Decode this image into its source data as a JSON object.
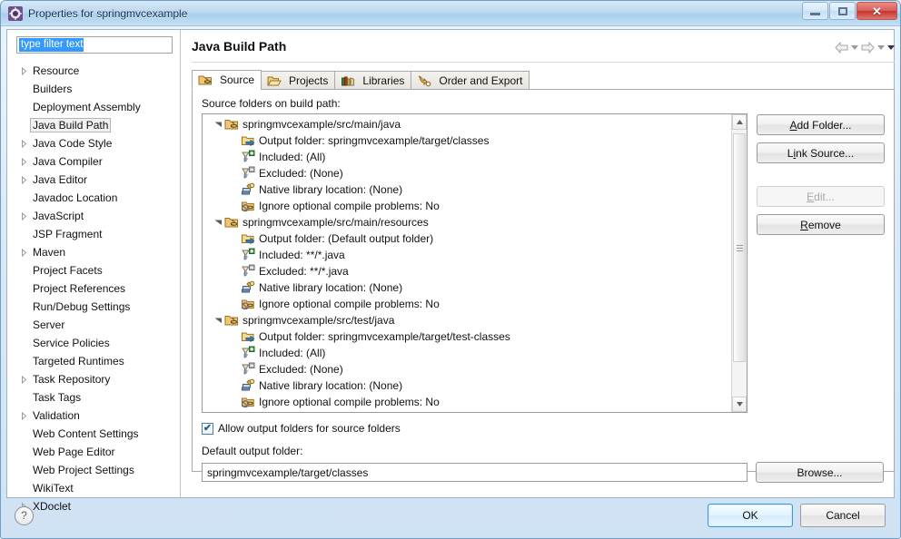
{
  "window": {
    "title": "Properties for springmvcexample",
    "icon": "properties-gear-icon",
    "buttons": {
      "minimize": "Minimize",
      "maximize": "Maximize",
      "close": "Close"
    }
  },
  "sidebar": {
    "filter": {
      "value": "type filter text",
      "placeholder": "type filter text"
    },
    "items": [
      {
        "label": "Resource",
        "expandable": true,
        "selected": false
      },
      {
        "label": "Builders",
        "expandable": false,
        "selected": false
      },
      {
        "label": "Deployment Assembly",
        "expandable": false,
        "selected": false
      },
      {
        "label": "Java Build Path",
        "expandable": false,
        "selected": true
      },
      {
        "label": "Java Code Style",
        "expandable": true,
        "selected": false
      },
      {
        "label": "Java Compiler",
        "expandable": true,
        "selected": false
      },
      {
        "label": "Java Editor",
        "expandable": true,
        "selected": false
      },
      {
        "label": "Javadoc Location",
        "expandable": false,
        "selected": false
      },
      {
        "label": "JavaScript",
        "expandable": true,
        "selected": false
      },
      {
        "label": "JSP Fragment",
        "expandable": false,
        "selected": false
      },
      {
        "label": "Maven",
        "expandable": true,
        "selected": false
      },
      {
        "label": "Project Facets",
        "expandable": false,
        "selected": false
      },
      {
        "label": "Project References",
        "expandable": false,
        "selected": false
      },
      {
        "label": "Run/Debug Settings",
        "expandable": false,
        "selected": false
      },
      {
        "label": "Server",
        "expandable": false,
        "selected": false
      },
      {
        "label": "Service Policies",
        "expandable": false,
        "selected": false
      },
      {
        "label": "Targeted Runtimes",
        "expandable": false,
        "selected": false
      },
      {
        "label": "Task Repository",
        "expandable": true,
        "selected": false
      },
      {
        "label": "Task Tags",
        "expandable": false,
        "selected": false
      },
      {
        "label": "Validation",
        "expandable": true,
        "selected": false
      },
      {
        "label": "Web Content Settings",
        "expandable": false,
        "selected": false
      },
      {
        "label": "Web Page Editor",
        "expandable": false,
        "selected": false
      },
      {
        "label": "Web Project Settings",
        "expandable": false,
        "selected": false
      },
      {
        "label": "WikiText",
        "expandable": false,
        "selected": false
      },
      {
        "label": "XDoclet",
        "expandable": true,
        "selected": false
      }
    ]
  },
  "page": {
    "title": "Java Build Path",
    "nav": {
      "back": "back-arrow",
      "back_menu": "back-history-dropdown",
      "forward": "forward-arrow",
      "forward_menu": "forward-history-dropdown",
      "menu": "view-menu"
    },
    "tabs": [
      {
        "label": "Source",
        "icon": "source-folder-icon",
        "active": true
      },
      {
        "label": "Projects",
        "icon": "open-folder-icon",
        "active": false
      },
      {
        "label": "Libraries",
        "icon": "books-icon",
        "active": false
      },
      {
        "label": "Order and Export",
        "icon": "order-export-icon",
        "active": false
      }
    ],
    "source_tab": {
      "list_label": "Source folders on build path:",
      "entries": [
        {
          "path": "springmvcexample/src/main/java",
          "details": [
            {
              "icon": "output-folder-icon",
              "text": "Output folder: springmvcexample/target/classes"
            },
            {
              "icon": "included-filter-icon",
              "text": "Included: (All)"
            },
            {
              "icon": "excluded-filter-icon",
              "text": "Excluded: (None)"
            },
            {
              "icon": "native-library-icon",
              "text": "Native library location: (None)"
            },
            {
              "icon": "ignore-problems-icon",
              "text": "Ignore optional compile problems: No"
            }
          ]
        },
        {
          "path": "springmvcexample/src/main/resources",
          "details": [
            {
              "icon": "output-folder-icon",
              "text": "Output folder: (Default output folder)"
            },
            {
              "icon": "included-filter-icon",
              "text": "Included: **/*.java"
            },
            {
              "icon": "excluded-filter-icon",
              "text": "Excluded: **/*.java"
            },
            {
              "icon": "native-library-icon",
              "text": "Native library location: (None)"
            },
            {
              "icon": "ignore-problems-icon",
              "text": "Ignore optional compile problems: No"
            }
          ]
        },
        {
          "path": "springmvcexample/src/test/java",
          "details": [
            {
              "icon": "output-folder-icon",
              "text": "Output folder: springmvcexample/target/test-classes"
            },
            {
              "icon": "included-filter-icon",
              "text": "Included: (All)"
            },
            {
              "icon": "excluded-filter-icon",
              "text": "Excluded: (None)"
            },
            {
              "icon": "native-library-icon",
              "text": "Native library location: (None)"
            },
            {
              "icon": "ignore-problems-icon",
              "text": "Ignore optional compile problems: No"
            }
          ]
        }
      ],
      "buttons": [
        {
          "label": "Add Folder...",
          "mnemonic": "A",
          "enabled": true
        },
        {
          "label": "Link Source...",
          "mnemonic": "i",
          "enabled": true
        },
        {
          "label": "Edit...",
          "mnemonic": "E",
          "enabled": false
        },
        {
          "label": "Remove",
          "mnemonic": "R",
          "enabled": true
        }
      ],
      "allow_output_folders": {
        "label": "Allow output folders for source folders",
        "checked": true
      },
      "default_output": {
        "label": "Default output folder:",
        "value": "springmvcexample/target/classes",
        "browse_label": "Browse..."
      }
    }
  },
  "footer": {
    "help": "?",
    "ok": "OK",
    "cancel": "Cancel"
  }
}
